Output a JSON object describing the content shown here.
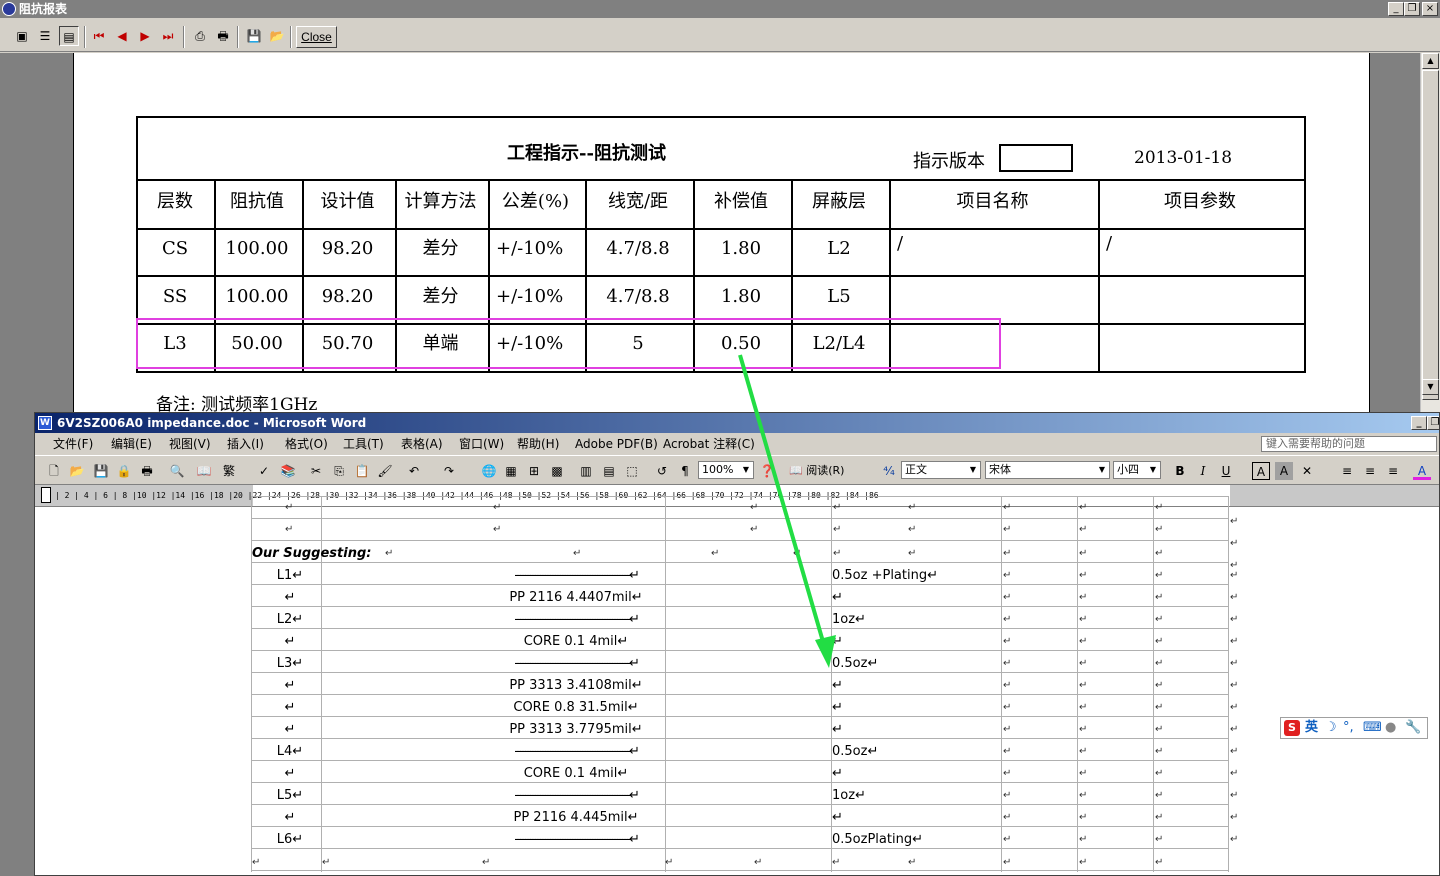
{
  "report_window": {
    "title": "阻抗报表",
    "close_label": "Close",
    "minimize_glyph": "_",
    "restore_glyph": "❐",
    "close_glyph": "×",
    "table_title": "工程指示--阻抗测试",
    "version_label": "指示版本",
    "date": "2013-01-18",
    "headers": [
      "层数",
      "阻抗值",
      "设计值",
      "计算方法",
      "公差(%)",
      "线宽/距",
      "补偿值",
      "屏蔽层",
      "项目名称",
      "项目参数"
    ],
    "rows": [
      [
        "CS",
        "100.00",
        "98.20",
        "差分",
        "+/-10%",
        "4.7/8.8",
        "1.80",
        "L2",
        "/",
        "/"
      ],
      [
        "SS",
        "100.00",
        "98.20",
        "差分",
        "+/-10%",
        "4.7/8.8",
        "1.80",
        "L5",
        "",
        ""
      ],
      [
        "L3",
        "50.00",
        "50.70",
        "单端",
        "+/-10%",
        "5",
        "0.50",
        "L2/L4",
        "",
        ""
      ]
    ],
    "remark": "备注: 测试频率1GHz",
    "scroll_up": "▲",
    "scroll_down": "▼"
  },
  "word_window": {
    "title": "6V2SZ006A0 impedance.doc - Microsoft Word",
    "menu": [
      "文件(F)",
      "编辑(E)",
      "视图(V)",
      "插入(I)",
      "格式(O)",
      "工具(T)",
      "表格(A)",
      "窗口(W)",
      "帮助(H)",
      "Adobe PDF(B)",
      "Acrobat 注释(C)"
    ],
    "help_placeholder": "键入需要帮助的问题",
    "zoom": "100%",
    "read_label": "阅读(R)",
    "style": "正文",
    "font": "宋体",
    "font_size": "小四",
    "ruler_ticks": "| 2 | 4 | 6 | 8 |10 |12 |14 |16 |18 |20 |22 |24 |26 |28 |30 |32 |34 |36 |38 |40 |42 |44 |46 |48 |50 |52 |54 |56 |58 |60 |62 |64 |66 |68 |70 |72 |74 |76 |78 |80 |82 |84 |86",
    "suggest_label": "Our Suggesting:",
    "stack": [
      {
        "layer": "L1",
        "mid": "----------------------------------------------",
        "cu": "0.5oz +Plating"
      },
      {
        "layer": "",
        "mid": "PP  2116  4.4407mil",
        "cu": ""
      },
      {
        "layer": "L2",
        "mid": "----------------------------------------------",
        "cu": "1oz"
      },
      {
        "layer": "",
        "mid": "CORE  0.1  4mil",
        "cu": ""
      },
      {
        "layer": "L3",
        "mid": "----------------------------------------------",
        "cu": "0.5oz"
      },
      {
        "layer": "",
        "mid": "PP  3313  3.4108mil",
        "cu": ""
      },
      {
        "layer": "",
        "mid": "CORE  0.8  31.5mil",
        "cu": ""
      },
      {
        "layer": "",
        "mid": "PP  3313  3.7795mil",
        "cu": ""
      },
      {
        "layer": "L4",
        "mid": "----------------------------------------------",
        "cu": "0.5oz"
      },
      {
        "layer": "",
        "mid": "CORE  0.1  4mil",
        "cu": ""
      },
      {
        "layer": "L5",
        "mid": "----------------------------------------------",
        "cu": "1oz"
      },
      {
        "layer": "",
        "mid": "PP  2116  4.445mil",
        "cu": ""
      },
      {
        "layer": "L6",
        "mid": "----------------------------------------------",
        "cu": "0.5ozPlating"
      }
    ],
    "para_mark": "↵",
    "ime_label": "英"
  },
  "colors": {
    "highlight_box": "#e040e0",
    "arrow": "#22dd44",
    "word_title": "#0a246a"
  }
}
